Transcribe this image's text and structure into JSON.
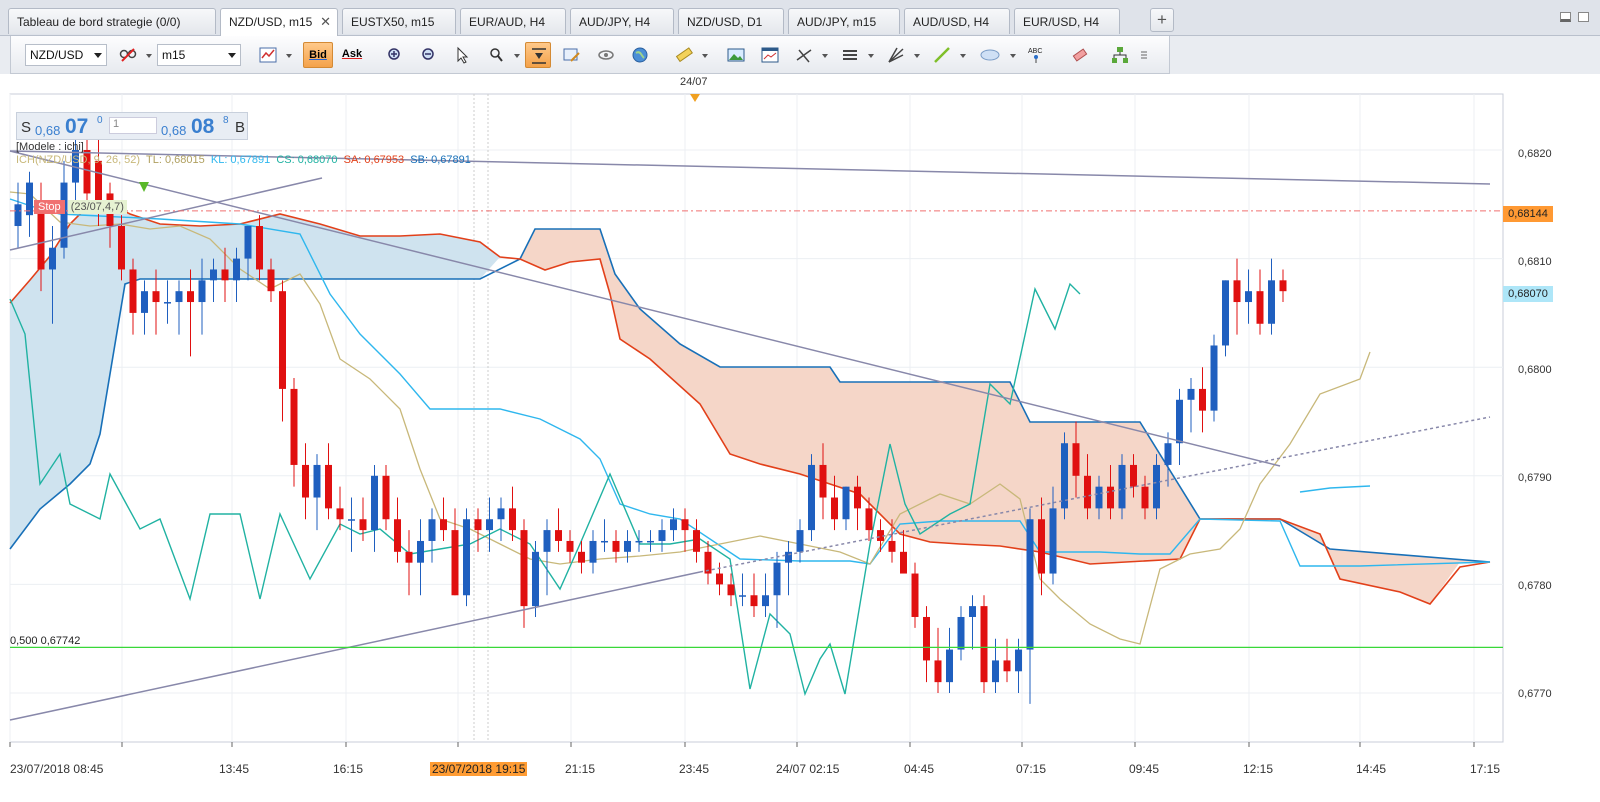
{
  "tabs": [
    {
      "label": "Tableau de bord strategie (0/0)",
      "active": false
    },
    {
      "label": "NZD/USD, m15",
      "active": true,
      "closable": true
    },
    {
      "label": "EUSTX50, m15",
      "active": false
    },
    {
      "label": "EUR/AUD, H4",
      "active": false
    },
    {
      "label": "AUD/JPY, H4",
      "active": false
    },
    {
      "label": "NZD/USD, D1",
      "active": false
    },
    {
      "label": "AUD/JPY, m15",
      "active": false
    },
    {
      "label": "AUD/USD, H4",
      "active": false
    },
    {
      "label": "EUR/USD, H4",
      "active": false
    }
  ],
  "toolbar": {
    "symbol": "NZD/USD",
    "timeframe": "m15",
    "bid_label": "Bid",
    "ask_label": "Ask"
  },
  "quote": {
    "sell_label": "S",
    "sell_prefix": "0,68",
    "sell_big": "07",
    "sell_sup": "0",
    "qty": "1",
    "buy_prefix": "0,68",
    "buy_big": "08",
    "buy_sup": "8",
    "buy_label": "B"
  },
  "legend": {
    "model": "[Modele : ichi]",
    "ichi": "ICH(NZD/USD, 9, 26, 52)",
    "tl": "TL: 0,68015",
    "kl": "KL: 0,67891",
    "cs": "CS: 0,68070",
    "sa": "SA: 0,67953",
    "sb": "SB: 0,67891"
  },
  "annotations": {
    "stop_label": "Stop",
    "stop_detail": "(23/07,4,7)",
    "fib_level": "0,500 0,67742",
    "top_date": "24/07"
  },
  "colors": {
    "up": "#1f5fbf",
    "down": "#e01010",
    "tenkan": "#c8b87a",
    "kijun": "#2fb7ee",
    "chikou": "#20b2a2",
    "senkou_a": "#e2401a",
    "senkou_b": "#1870b8",
    "kumo_bull": "#cfe3ef",
    "kumo_bear": "#f5d6c8",
    "fib": "#38d838",
    "stop_line": "#f07070"
  },
  "chart_data": {
    "type": "candlestick",
    "symbol": "NZD/USD",
    "timeframe": "m15",
    "ylim": [
      0.6765,
      0.6827
    ],
    "y_ticks": [
      "0,6770",
      "0,6780",
      "0,6790",
      "0,6800",
      "0,6810",
      "0,6820"
    ],
    "price_tags": [
      {
        "label": "0,68144",
        "value": 0.68144,
        "bg": "#ff9933"
      },
      {
        "label": "0,68070",
        "value": 0.6807,
        "bg": "#aee6f8"
      }
    ],
    "x_ticks": [
      "23/07/2018 08:45",
      "13:45",
      "16:15",
      "23/07/2018 19:15",
      "21:15",
      "23:45",
      "24/07 02:15",
      "04:45",
      "07:15",
      "09:45",
      "12:15",
      "14:45",
      "17:15"
    ],
    "candles": [
      {
        "o": 0.6813,
        "h": 0.6817,
        "l": 0.6811,
        "c": 0.6815
      },
      {
        "o": 0.6814,
        "h": 0.6818,
        "l": 0.6812,
        "c": 0.6817
      },
      {
        "o": 0.6815,
        "h": 0.6817,
        "l": 0.6807,
        "c": 0.6809
      },
      {
        "o": 0.6809,
        "h": 0.6813,
        "l": 0.6804,
        "c": 0.6811
      },
      {
        "o": 0.6811,
        "h": 0.6819,
        "l": 0.681,
        "c": 0.6817
      },
      {
        "o": 0.6817,
        "h": 0.6822,
        "l": 0.6815,
        "c": 0.682
      },
      {
        "o": 0.682,
        "h": 0.6822,
        "l": 0.6815,
        "c": 0.6816
      },
      {
        "o": 0.6819,
        "h": 0.6821,
        "l": 0.6813,
        "c": 0.6815
      },
      {
        "o": 0.6816,
        "h": 0.6817,
        "l": 0.6811,
        "c": 0.6813
      },
      {
        "o": 0.6813,
        "h": 0.6814,
        "l": 0.6808,
        "c": 0.6809
      },
      {
        "o": 0.6809,
        "h": 0.681,
        "l": 0.6803,
        "c": 0.6805
      },
      {
        "o": 0.6805,
        "h": 0.6808,
        "l": 0.6803,
        "c": 0.6807
      },
      {
        "o": 0.6807,
        "h": 0.6809,
        "l": 0.6803,
        "c": 0.6806
      },
      {
        "o": 0.6806,
        "h": 0.6808,
        "l": 0.6804,
        "c": 0.6806
      },
      {
        "o": 0.6806,
        "h": 0.6808,
        "l": 0.6803,
        "c": 0.6807
      },
      {
        "o": 0.6807,
        "h": 0.6809,
        "l": 0.6801,
        "c": 0.6806
      },
      {
        "o": 0.6806,
        "h": 0.681,
        "l": 0.6803,
        "c": 0.6808
      },
      {
        "o": 0.6808,
        "h": 0.681,
        "l": 0.6806,
        "c": 0.6809
      },
      {
        "o": 0.6809,
        "h": 0.6811,
        "l": 0.6806,
        "c": 0.6808
      },
      {
        "o": 0.6808,
        "h": 0.6811,
        "l": 0.6806,
        "c": 0.681
      },
      {
        "o": 0.681,
        "h": 0.6813,
        "l": 0.6808,
        "c": 0.6813
      },
      {
        "o": 0.6813,
        "h": 0.6814,
        "l": 0.6808,
        "c": 0.6809
      },
      {
        "o": 0.6809,
        "h": 0.681,
        "l": 0.6806,
        "c": 0.6807
      },
      {
        "o": 0.6807,
        "h": 0.6808,
        "l": 0.6795,
        "c": 0.6798
      },
      {
        "o": 0.6798,
        "h": 0.6799,
        "l": 0.6789,
        "c": 0.6791
      },
      {
        "o": 0.6791,
        "h": 0.6793,
        "l": 0.6786,
        "c": 0.6788
      },
      {
        "o": 0.6788,
        "h": 0.6792,
        "l": 0.6785,
        "c": 0.6791
      },
      {
        "o": 0.6791,
        "h": 0.6793,
        "l": 0.6786,
        "c": 0.6787
      },
      {
        "o": 0.6787,
        "h": 0.6789,
        "l": 0.6785,
        "c": 0.6786
      },
      {
        "o": 0.6786,
        "h": 0.6788,
        "l": 0.6783,
        "c": 0.6786
      },
      {
        "o": 0.6786,
        "h": 0.6788,
        "l": 0.6784,
        "c": 0.6785
      },
      {
        "o": 0.6785,
        "h": 0.6791,
        "l": 0.6783,
        "c": 0.679
      },
      {
        "o": 0.679,
        "h": 0.6791,
        "l": 0.6785,
        "c": 0.6786
      },
      {
        "o": 0.6786,
        "h": 0.6788,
        "l": 0.6782,
        "c": 0.6783
      },
      {
        "o": 0.6783,
        "h": 0.6785,
        "l": 0.6779,
        "c": 0.6782
      },
      {
        "o": 0.6782,
        "h": 0.6786,
        "l": 0.6779,
        "c": 0.6784
      },
      {
        "o": 0.6784,
        "h": 0.6787,
        "l": 0.6782,
        "c": 0.6786
      },
      {
        "o": 0.6786,
        "h": 0.6788,
        "l": 0.6784,
        "c": 0.6785
      },
      {
        "o": 0.6785,
        "h": 0.6787,
        "l": 0.6779,
        "c": 0.6779
      },
      {
        "o": 0.6779,
        "h": 0.6787,
        "l": 0.6778,
        "c": 0.6786
      },
      {
        "o": 0.6786,
        "h": 0.6787,
        "l": 0.6783,
        "c": 0.6785
      },
      {
        "o": 0.6785,
        "h": 0.6788,
        "l": 0.6783,
        "c": 0.6786
      },
      {
        "o": 0.6786,
        "h": 0.6788,
        "l": 0.6784,
        "c": 0.6787
      },
      {
        "o": 0.6787,
        "h": 0.6789,
        "l": 0.6784,
        "c": 0.6785
      },
      {
        "o": 0.6785,
        "h": 0.6786,
        "l": 0.6776,
        "c": 0.6778
      },
      {
        "o": 0.6778,
        "h": 0.6784,
        "l": 0.6777,
        "c": 0.6783
      },
      {
        "o": 0.6783,
        "h": 0.6786,
        "l": 0.6779,
        "c": 0.6785
      },
      {
        "o": 0.6785,
        "h": 0.6787,
        "l": 0.6783,
        "c": 0.6784
      },
      {
        "o": 0.6784,
        "h": 0.6785,
        "l": 0.6782,
        "c": 0.6783
      },
      {
        "o": 0.6783,
        "h": 0.6784,
        "l": 0.6781,
        "c": 0.6782
      },
      {
        "o": 0.6782,
        "h": 0.6785,
        "l": 0.6781,
        "c": 0.6784
      },
      {
        "o": 0.6784,
        "h": 0.6786,
        "l": 0.6783,
        "c": 0.6784
      },
      {
        "o": 0.6784,
        "h": 0.6785,
        "l": 0.6782,
        "c": 0.6783
      },
      {
        "o": 0.6783,
        "h": 0.6785,
        "l": 0.6782,
        "c": 0.6784
      },
      {
        "o": 0.6784,
        "h": 0.6785,
        "l": 0.6783,
        "c": 0.6784
      },
      {
        "o": 0.6784,
        "h": 0.6785,
        "l": 0.6783,
        "c": 0.6784
      },
      {
        "o": 0.6784,
        "h": 0.6786,
        "l": 0.6783,
        "c": 0.6785
      },
      {
        "o": 0.6785,
        "h": 0.6787,
        "l": 0.6784,
        "c": 0.6786
      },
      {
        "o": 0.6786,
        "h": 0.6787,
        "l": 0.6783,
        "c": 0.6785
      },
      {
        "o": 0.6785,
        "h": 0.6786,
        "l": 0.6782,
        "c": 0.6783
      },
      {
        "o": 0.6783,
        "h": 0.6784,
        "l": 0.678,
        "c": 0.6781
      },
      {
        "o": 0.6781,
        "h": 0.6782,
        "l": 0.6779,
        "c": 0.678
      },
      {
        "o": 0.678,
        "h": 0.6781,
        "l": 0.6778,
        "c": 0.6779
      },
      {
        "o": 0.6779,
        "h": 0.6781,
        "l": 0.6778,
        "c": 0.6779
      },
      {
        "o": 0.6779,
        "h": 0.6781,
        "l": 0.6777,
        "c": 0.6778
      },
      {
        "o": 0.6778,
        "h": 0.6781,
        "l": 0.6777,
        "c": 0.6779
      },
      {
        "o": 0.6779,
        "h": 0.6783,
        "l": 0.6776,
        "c": 0.6782
      },
      {
        "o": 0.6782,
        "h": 0.6784,
        "l": 0.6779,
        "c": 0.6783
      },
      {
        "o": 0.6783,
        "h": 0.6786,
        "l": 0.6782,
        "c": 0.6785
      },
      {
        "o": 0.6785,
        "h": 0.6792,
        "l": 0.6784,
        "c": 0.6791
      },
      {
        "o": 0.6791,
        "h": 0.6793,
        "l": 0.6786,
        "c": 0.6788
      },
      {
        "o": 0.6788,
        "h": 0.679,
        "l": 0.6785,
        "c": 0.6786
      },
      {
        "o": 0.6786,
        "h": 0.6789,
        "l": 0.6785,
        "c": 0.6789
      },
      {
        "o": 0.6789,
        "h": 0.679,
        "l": 0.6785,
        "c": 0.6787
      },
      {
        "o": 0.6787,
        "h": 0.6788,
        "l": 0.6784,
        "c": 0.6785
      },
      {
        "o": 0.6785,
        "h": 0.6786,
        "l": 0.6783,
        "c": 0.6784
      },
      {
        "o": 0.6784,
        "h": 0.6786,
        "l": 0.6782,
        "c": 0.6783
      },
      {
        "o": 0.6783,
        "h": 0.6785,
        "l": 0.6781,
        "c": 0.6781
      },
      {
        "o": 0.6781,
        "h": 0.6782,
        "l": 0.6776,
        "c": 0.6777
      },
      {
        "o": 0.6777,
        "h": 0.6778,
        "l": 0.6771,
        "c": 0.6773
      },
      {
        "o": 0.6773,
        "h": 0.6776,
        "l": 0.677,
        "c": 0.6771
      },
      {
        "o": 0.6771,
        "h": 0.6776,
        "l": 0.677,
        "c": 0.6774
      },
      {
        "o": 0.6774,
        "h": 0.6778,
        "l": 0.6773,
        "c": 0.6777
      },
      {
        "o": 0.6777,
        "h": 0.6779,
        "l": 0.6774,
        "c": 0.6778
      },
      {
        "o": 0.6778,
        "h": 0.6779,
        "l": 0.677,
        "c": 0.6771
      },
      {
        "o": 0.6771,
        "h": 0.6775,
        "l": 0.677,
        "c": 0.6773
      },
      {
        "o": 0.6773,
        "h": 0.6775,
        "l": 0.6771,
        "c": 0.6772
      },
      {
        "o": 0.6772,
        "h": 0.6775,
        "l": 0.677,
        "c": 0.6774
      },
      {
        "o": 0.6774,
        "h": 0.6787,
        "l": 0.6769,
        "c": 0.6786
      },
      {
        "o": 0.6786,
        "h": 0.6788,
        "l": 0.6779,
        "c": 0.6781
      },
      {
        "o": 0.6781,
        "h": 0.6789,
        "l": 0.678,
        "c": 0.6787
      },
      {
        "o": 0.6787,
        "h": 0.6794,
        "l": 0.6786,
        "c": 0.6793
      },
      {
        "o": 0.6793,
        "h": 0.6795,
        "l": 0.6788,
        "c": 0.679
      },
      {
        "o": 0.679,
        "h": 0.6792,
        "l": 0.6786,
        "c": 0.6787
      },
      {
        "o": 0.6787,
        "h": 0.679,
        "l": 0.6786,
        "c": 0.6789
      },
      {
        "o": 0.6789,
        "h": 0.6791,
        "l": 0.6786,
        "c": 0.6787
      },
      {
        "o": 0.6787,
        "h": 0.6792,
        "l": 0.6786,
        "c": 0.6791
      },
      {
        "o": 0.6791,
        "h": 0.6792,
        "l": 0.6788,
        "c": 0.6789
      },
      {
        "o": 0.6789,
        "h": 0.679,
        "l": 0.6786,
        "c": 0.6787
      },
      {
        "o": 0.6787,
        "h": 0.6792,
        "l": 0.6786,
        "c": 0.6791
      },
      {
        "o": 0.6791,
        "h": 0.6794,
        "l": 0.6789,
        "c": 0.6793
      },
      {
        "o": 0.6793,
        "h": 0.6798,
        "l": 0.6791,
        "c": 0.6797
      },
      {
        "o": 0.6797,
        "h": 0.6799,
        "l": 0.6794,
        "c": 0.6798
      },
      {
        "o": 0.6798,
        "h": 0.68,
        "l": 0.6794,
        "c": 0.6796
      },
      {
        "o": 0.6796,
        "h": 0.6803,
        "l": 0.6795,
        "c": 0.6802
      },
      {
        "o": 0.6802,
        "h": 0.6808,
        "l": 0.6801,
        "c": 0.6808
      },
      {
        "o": 0.6808,
        "h": 0.681,
        "l": 0.6803,
        "c": 0.6806
      },
      {
        "o": 0.6806,
        "h": 0.6809,
        "l": 0.6804,
        "c": 0.6807
      },
      {
        "o": 0.6807,
        "h": 0.6809,
        "l": 0.6803,
        "c": 0.6804
      },
      {
        "o": 0.6804,
        "h": 0.681,
        "l": 0.6803,
        "c": 0.6808
      },
      {
        "o": 0.6808,
        "h": 0.6809,
        "l": 0.6806,
        "c": 0.6807
      }
    ]
  }
}
